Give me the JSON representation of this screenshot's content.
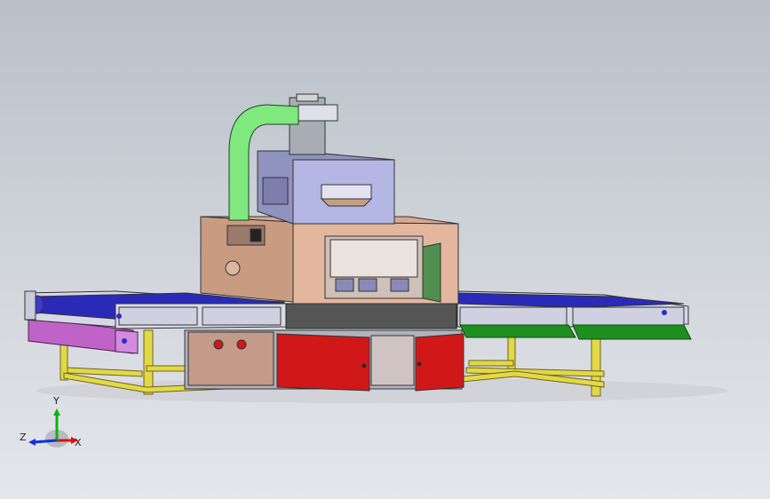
{
  "viewport": {
    "background_top": "#b9c0c9",
    "background_bottom": "#e4e6ea"
  },
  "model": {
    "frame_color": "#e3d846",
    "cabinet_color": "#e3b79e",
    "hood_color": "#b4b6e3",
    "duct_color": "#7fe87f",
    "belt_color": "#2a2ab8",
    "door_color": "#d01818",
    "tray_color": "#1e8f1e",
    "left_panel_color": "#c063c8"
  },
  "triad": {
    "x_label": "X",
    "y_label": "Y",
    "z_label": "Z",
    "x_color": "#e01010",
    "y_color": "#10b010",
    "z_color": "#1030e0"
  }
}
